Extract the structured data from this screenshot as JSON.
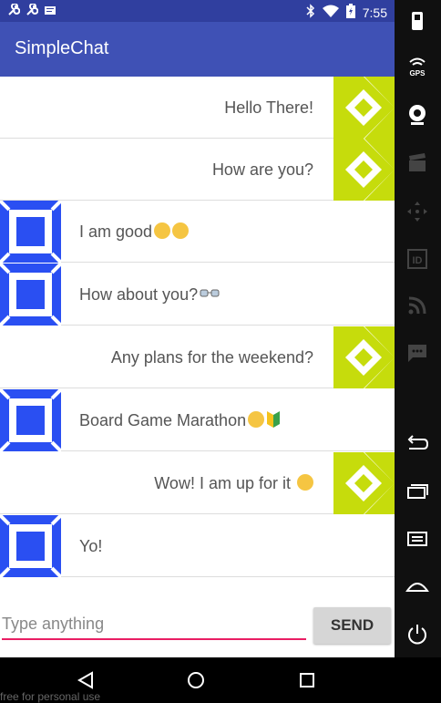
{
  "status": {
    "time": "7:55"
  },
  "app": {
    "title": "SimpleChat"
  },
  "messages": [
    {
      "text": "Hello There!",
      "side": "right"
    },
    {
      "text": "How are you?",
      "side": "right"
    },
    {
      "text": "I am good",
      "side": "left"
    },
    {
      "text": "How about you?",
      "side": "left"
    },
    {
      "text": "Any plans for the weekend?",
      "side": "right"
    },
    {
      "text": "Board Game Marathon",
      "side": "left"
    },
    {
      "text": "Wow! I am up for it",
      "side": "right"
    },
    {
      "text": "Yo!",
      "side": "left"
    }
  ],
  "composer": {
    "placeholder": "Type anything",
    "send_label": "SEND"
  },
  "footer": {
    "watermark": "free for personal use"
  },
  "colors": {
    "appbar": "#3f51b5",
    "statusbar": "#303f9f",
    "accent": "#e91e63",
    "avatar_right": "#c6dc0c",
    "avatar_left": "#2a4ff2"
  },
  "icons": [
    "wrench-icon",
    "wrench-icon",
    "message-icon",
    "bluetooth-icon",
    "wifi-icon",
    "battery-icon",
    "battery-side-icon",
    "gps-icon",
    "webcam-icon",
    "clapper-icon",
    "dpad-icon",
    "id-icon",
    "rss-icon",
    "sms-icon",
    "back-icon",
    "recents-icon",
    "menu-icon",
    "home-icon",
    "power-icon",
    "more-icon"
  ]
}
